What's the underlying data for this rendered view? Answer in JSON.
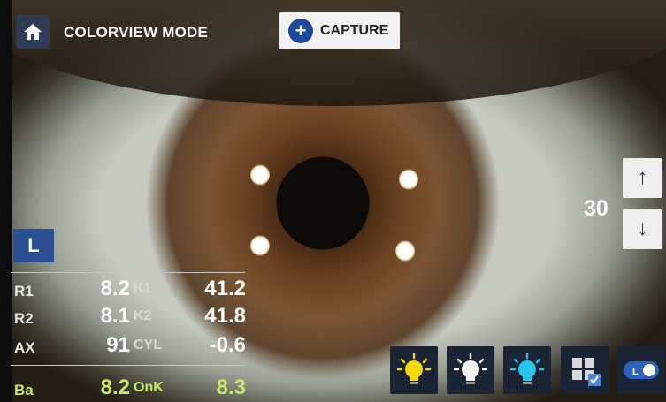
{
  "header": {
    "mode_title": "COLORVIEW MODE",
    "capture_label": "CAPTURE",
    "icons": {
      "home": "home-icon",
      "capture": "plus-circle-icon"
    }
  },
  "eye_side": "L",
  "zoom": {
    "value": "30",
    "up_label": "↑",
    "down_label": "↓"
  },
  "keratometry": {
    "rows": [
      {
        "label": "R1",
        "value": "8.2",
        "sub_label": "K1",
        "sub_value": "41.2"
      },
      {
        "label": "R2",
        "value": "8.1",
        "sub_label": "K2",
        "sub_value": "41.8"
      },
      {
        "label": "AX",
        "value": "91",
        "sub_label": "CYL",
        "sub_value": "-0.6"
      },
      {
        "label": "Ba",
        "value": "8.2",
        "sub_label": "OnK",
        "sub_value": "8.3"
      }
    ]
  },
  "toolbar": {
    "buttons": [
      {
        "name": "yellow-light-icon",
        "color": "#f5d90a"
      },
      {
        "name": "white-light-icon",
        "color": "#f4f4f4"
      },
      {
        "name": "blue-light-icon",
        "color": "#27c4ea"
      },
      {
        "name": "grid-check-icon",
        "color": "#4a86d8"
      },
      {
        "name": "toggle-switch-icon",
        "color": "#2a63b8"
      }
    ]
  },
  "colors": {
    "accent_blue": "#2c4f92",
    "ba_row_green": "#c6e86a",
    "capture_background": "#f1f1f1"
  }
}
